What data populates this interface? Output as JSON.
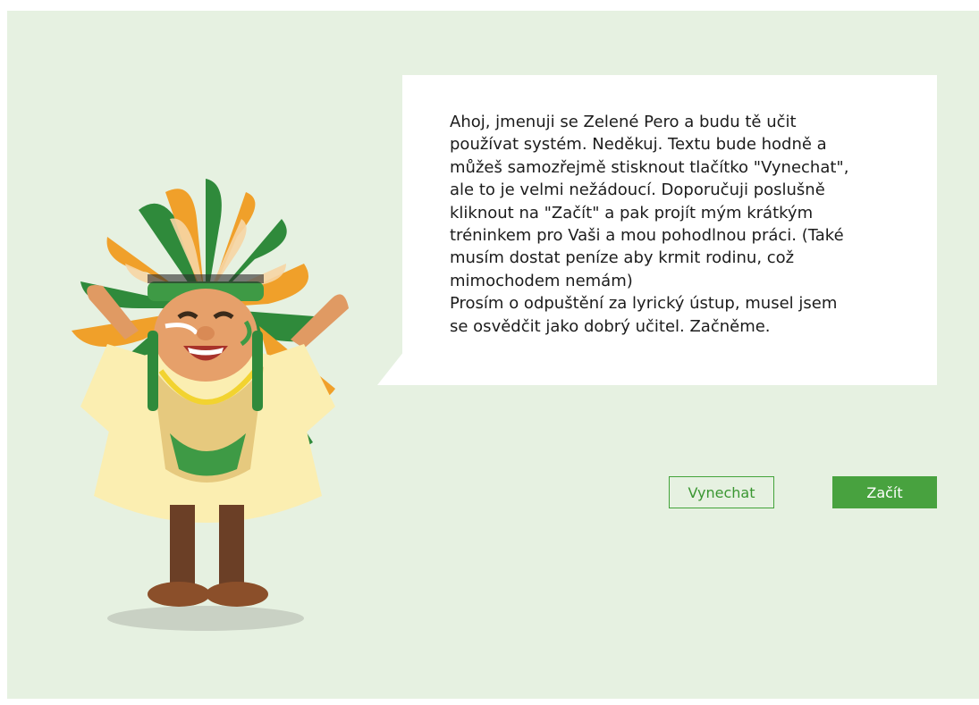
{
  "dialog": {
    "message": "Ahoj, jmenuji se Zelené Pero a budu tě učit\npoužívat systém. Neděkuj. Textu bude hodně a\nmůžeš samozřejmě stisknout tlačítko \"Vynechat\",\nale to je velmi nežádoucí. Doporučuji poslušně\nkliknout na \"Začít\" a pak projít mým krátkým\ntréninkem pro Vaši a mou pohodlnou práci. (Také\nmusím dostat peníze aby krmit rodinu, což\nmimochodem nemám)\nProsím o odpuštění za lyrický ústup, musel jsem\nse osvědčit jako dobrý učitel. Začněme."
  },
  "buttons": {
    "skip_label": "Vynechat",
    "start_label": "Začít"
  },
  "colors": {
    "background": "#e6f1e1",
    "accent": "#48a23f",
    "bubble": "#ffffff"
  },
  "mascot": {
    "icon": "native-chief-mascot-icon"
  }
}
